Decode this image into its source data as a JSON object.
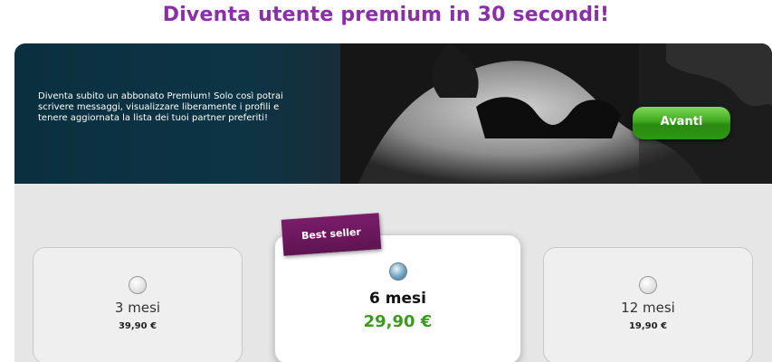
{
  "header": {
    "title": "Diventa utente premium in 30 secondi!"
  },
  "banner": {
    "text": "Diventa subito un abbonato Premium! Solo così potrai scrivere messaggi, visualizzare liberamente i profili e tenere aggiornata la lista dei tuoi partner preferiti!",
    "cta_label": "Avanti"
  },
  "plans": {
    "badge": "Best seller",
    "options": [
      {
        "term": "3 mesi",
        "price": "39,90 €",
        "selected": false
      },
      {
        "term": "6 mesi",
        "price": "29,90 €",
        "selected": true
      },
      {
        "term": "12 mesi",
        "price": "19,90 €",
        "selected": false
      }
    ]
  },
  "colors": {
    "title": "#8a2fa8",
    "cta": "#3fa81e",
    "price_highlight": "#3a9a1d",
    "badge": "#6a1a5e"
  }
}
